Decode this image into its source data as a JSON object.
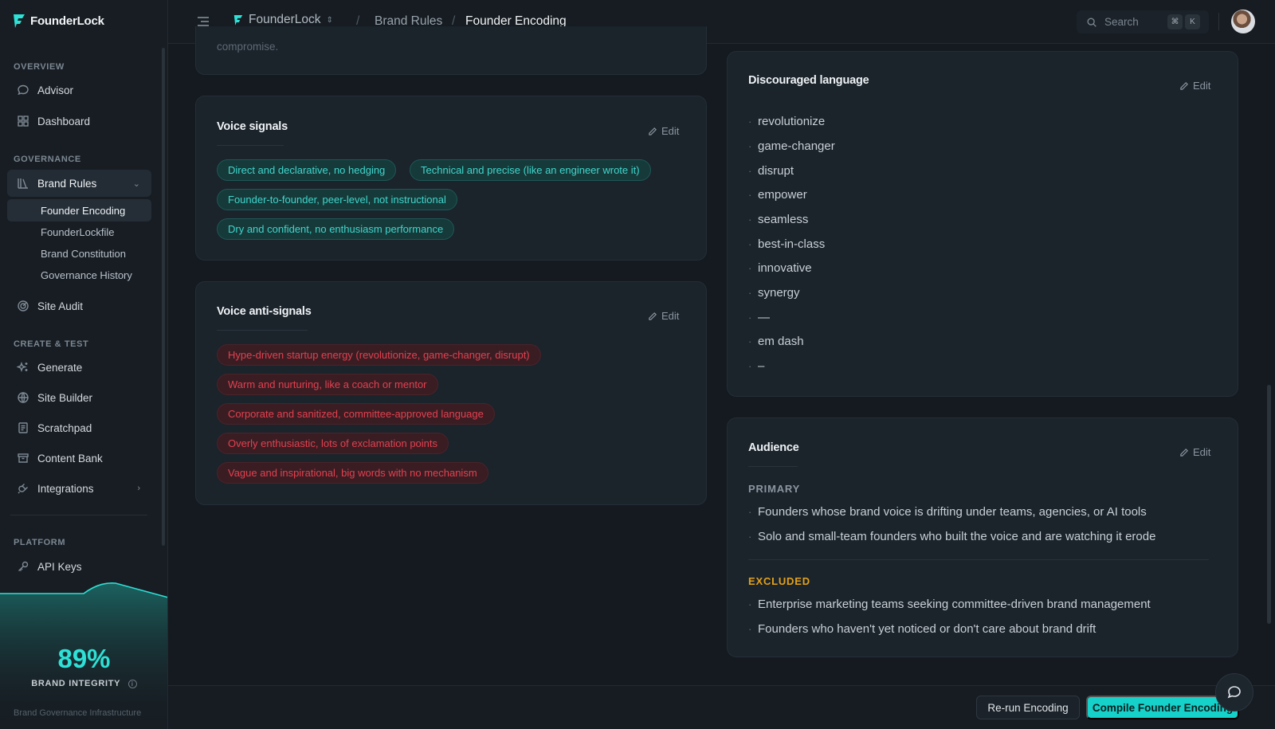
{
  "app": {
    "name": "FounderLock"
  },
  "sidebar": {
    "sections": {
      "overview": "OVERVIEW",
      "governance": "GOVERNANCE",
      "create": "CREATE & TEST",
      "platform": "PLATFORM"
    },
    "items": {
      "advisor": "Advisor",
      "dashboard": "Dashboard",
      "brand_rules": "Brand Rules",
      "founder_encoding": "Founder Encoding",
      "founder_lockfile": "FounderLockfile",
      "brand_constitution": "Brand Constitution",
      "governance_history": "Governance History",
      "site_audit": "Site Audit",
      "generate": "Generate",
      "site_builder": "Site Builder",
      "scratchpad": "Scratchpad",
      "content_bank": "Content Bank",
      "integrations": "Integrations",
      "api_keys": "API Keys"
    },
    "integrity": {
      "value": "89%",
      "level": 0.89,
      "label": "BRAND INTEGRITY",
      "footer": "Brand Governance Infrastructure"
    }
  },
  "topbar": {
    "workspace": "FounderLock",
    "crumb_parent": "Brand Rules",
    "crumb_current": "Founder Encoding",
    "search_placeholder": "Search",
    "kbd_mod": "⌘",
    "kbd_key": "K"
  },
  "cards": {
    "top_partial_text": "compromise.",
    "edit_label": "Edit",
    "voice_signals": {
      "title": "Voice signals",
      "chips": [
        "Direct and declarative, no hedging",
        "Technical and precise (like an engineer wrote it)",
        "Founder-to-founder, peer-level, not instructional",
        "Dry and confident, no enthusiasm performance"
      ]
    },
    "voice_anti_signals": {
      "title": "Voice anti-signals",
      "chips": [
        "Hype-driven startup energy (revolutionize, game-changer, disrupt)",
        "Warm and nurturing, like a coach or mentor",
        "Corporate and sanitized, committee-approved language",
        "Overly enthusiastic, lots of exclamation points",
        "Vague and inspirational, big words with no mechanism"
      ]
    },
    "discouraged": {
      "title": "Discouraged language",
      "words": [
        "revolutionize",
        "game-changer",
        "disrupt",
        "empower",
        "seamless",
        "best-in-class",
        "innovative",
        "synergy",
        "—",
        "em dash",
        "–"
      ]
    },
    "audience": {
      "title": "Audience",
      "primary_label": "PRIMARY",
      "primary": [
        "Founders whose brand voice is drifting under teams, agencies, or AI tools",
        "Solo and small-team founders who built the voice and are watching it erode"
      ],
      "excluded_label": "EXCLUDED",
      "excluded": [
        "Enterprise marketing teams seeking committee-driven brand management",
        "Founders who haven't yet noticed or don't care about brand drift"
      ]
    }
  },
  "actions": {
    "rerun": "Re-run Encoding",
    "compile": "Compile Founder Encoding"
  },
  "colors": {
    "accent": "#16d1c9",
    "signal_text": "#3fd6cc",
    "anti_signal_text": "#e2404f",
    "excluded_label": "#e3a21a",
    "primary_label": "#8b96a0"
  }
}
